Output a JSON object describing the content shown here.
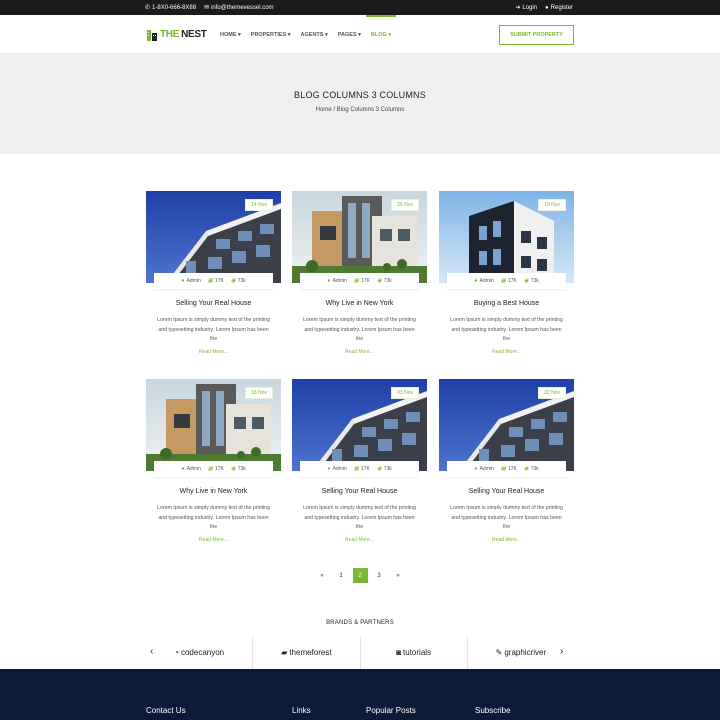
{
  "topbar": {
    "phone": "1-8X0-666-8X88",
    "email": "info@themevessel.com",
    "login": "Login",
    "register": "Register"
  },
  "brand": {
    "part1": "THE",
    "part2": "NEST"
  },
  "menu": [
    {
      "label": "HOME ▾"
    },
    {
      "label": "PROPERTIES ▾"
    },
    {
      "label": "AGENTS ▾"
    },
    {
      "label": "PAGES ▾"
    },
    {
      "label": "BLOG ▾"
    }
  ],
  "nav": {
    "submit": "SUBMIT PROPERTY"
  },
  "hero": {
    "title": "BLOG COLUMNS 3 COLUMNS",
    "crumb_home": "Home",
    "crumb_sep": "/",
    "crumb_current": "Blog Columns 3 Columns"
  },
  "posts": [
    {
      "date": "14 Nov",
      "author": "Admin",
      "views": "17K",
      "comments": "73k",
      "title": "Selling Your Real House",
      "text": "Lorem Ipsum is simply dummy text of the printing and typesetting industry. Lorem Ipsum has been the",
      "more": "Read More..."
    },
    {
      "date": "25 Nov",
      "author": "Admin",
      "views": "17K",
      "comments": "73k",
      "title": "Why Live in New York",
      "text": "Lorem Ipsum is simply dummy text of the printing and typesetting industry. Lorem Ipsum has been the",
      "more": "Read More..."
    },
    {
      "date": "19 Nov",
      "author": "Admin",
      "views": "17K",
      "comments": "73k",
      "title": "Buying a Best House",
      "text": "Lorem Ipsum is simply dummy text of the printing and typesetting industry. Lorem Ipsum has been the",
      "more": "Read More..."
    },
    {
      "date": "18 Nov",
      "author": "Admin",
      "views": "17K",
      "comments": "73k",
      "title": "Why Live in New York",
      "text": "Lorem Ipsum is simply dummy text of the printing and typesetting industry. Lorem Ipsum has been the",
      "more": "Read More..."
    },
    {
      "date": "03 Nov",
      "author": "Admin",
      "views": "17K",
      "comments": "73k",
      "title": "Selling Your Real House",
      "text": "Lorem Ipsum is simply dummy text of the printing and typesetting industry. Lorem Ipsum has been the",
      "more": "Read More..."
    },
    {
      "date": "22 Nov",
      "author": "Admin",
      "views": "17K",
      "comments": "73k",
      "title": "Selling Your Real House",
      "text": "Lorem Ipsum is simply dummy text of the printing and typesetting industry. Lorem Ipsum has been the",
      "more": "Read More..."
    }
  ],
  "pagination": {
    "prev": "«",
    "pages": [
      "1",
      "2",
      "3"
    ],
    "current": "2",
    "next": "»"
  },
  "brands": {
    "title": "BRANDS & PARTNERS",
    "items": [
      "codecanyon",
      "themeforest",
      "tutorials",
      "graphicriver"
    ],
    "prev": "‹",
    "next": "›"
  },
  "footer": {
    "contact": "Contact Us",
    "links": "Links",
    "popular": "Popular Posts",
    "subscribe": "Subscribe"
  },
  "colors": {
    "accent": "#7cb82f",
    "footer_bg": "#0b1a36",
    "topbar_bg": "#1b1b1b",
    "hero_bg": "#efefef"
  }
}
